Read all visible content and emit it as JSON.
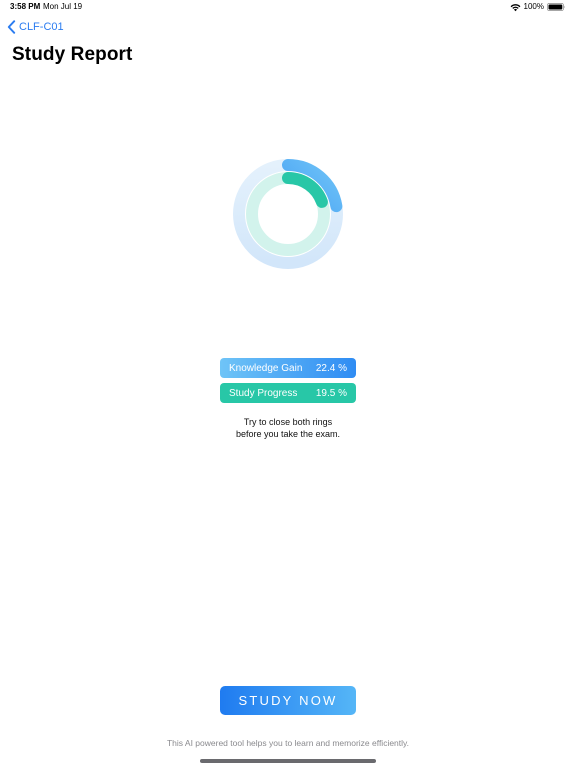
{
  "status_bar": {
    "time": "3:58 PM",
    "date": "Mon Jul 19",
    "battery": "100%",
    "wifi_icon": "wifi-icon",
    "battery_icon": "battery-icon"
  },
  "nav": {
    "back_label": "CLF-C01",
    "back_icon": "chevron-left-icon"
  },
  "page": {
    "title": "Study Report"
  },
  "metrics": {
    "knowledge_gain": {
      "label": "Knowledge Gain",
      "value_text": "22.4 %",
      "value": 22.4
    },
    "study_progress": {
      "label": "Study Progress",
      "value_text": "19.5 %",
      "value": 19.5
    }
  },
  "hint": {
    "line1": "Try to close both rings",
    "line2": "before you take the exam."
  },
  "cta": {
    "label": "STUDY NOW"
  },
  "footer": {
    "text": "This AI powered tool helps you to learn and memorize efficiently."
  },
  "colors": {
    "accent_blue": "#2b7cf0",
    "gain_track": "#dcecfb",
    "gain_start": "#6fc4f7",
    "gain_end": "#1f7bf0",
    "progress_track": "#d4f4ee",
    "progress_color": "#28c7a7"
  }
}
